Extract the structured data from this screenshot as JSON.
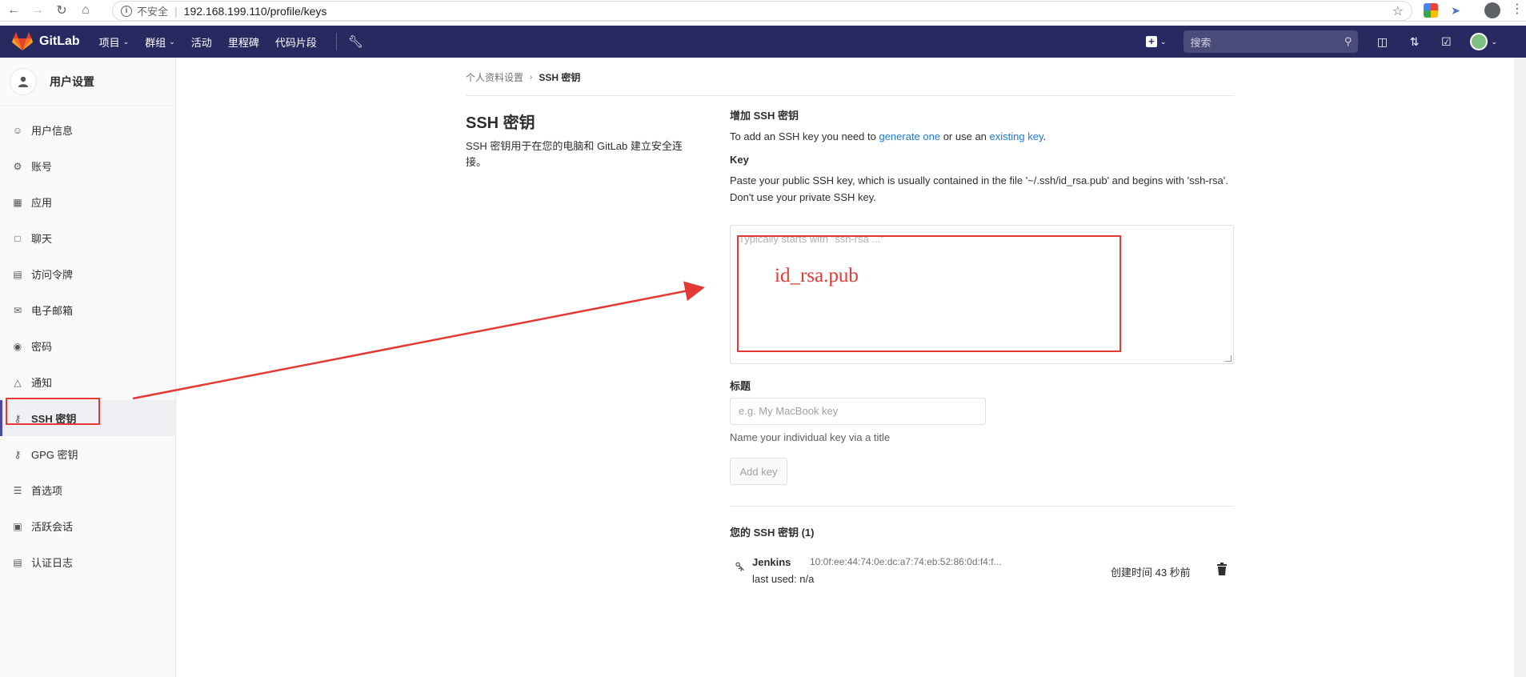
{
  "browser": {
    "insecure_label": "不安全",
    "url": "192.168.199.110/profile/keys"
  },
  "navbar": {
    "brand": "GitLab",
    "menu": [
      {
        "label": "项目",
        "has_caret": true
      },
      {
        "label": "群组",
        "has_caret": true
      },
      {
        "label": "活动",
        "has_caret": false
      },
      {
        "label": "里程碑",
        "has_caret": false
      },
      {
        "label": "代码片段",
        "has_caret": false
      }
    ],
    "search_placeholder": "搜索"
  },
  "sidebar": {
    "title": "用户设置",
    "items": [
      {
        "label": "用户信息",
        "icon": "profile-icon"
      },
      {
        "label": "账号",
        "icon": "account-icon"
      },
      {
        "label": "应用",
        "icon": "applications-icon"
      },
      {
        "label": "聊天",
        "icon": "chat-icon"
      },
      {
        "label": "访问令牌",
        "icon": "token-icon"
      },
      {
        "label": "电子邮箱",
        "icon": "mail-icon"
      },
      {
        "label": "密码",
        "icon": "lock-icon"
      },
      {
        "label": "通知",
        "icon": "bell-icon"
      },
      {
        "label": "SSH 密钥",
        "icon": "key-icon",
        "active": true
      },
      {
        "label": "GPG 密钥",
        "icon": "key-icon"
      },
      {
        "label": "首选项",
        "icon": "preferences-icon"
      },
      {
        "label": "活跃会话",
        "icon": "monitor-icon"
      },
      {
        "label": "认证日志",
        "icon": "log-icon"
      }
    ]
  },
  "breadcrumb": {
    "parent": "个人资料设置",
    "current": "SSH 密钥"
  },
  "intro": {
    "title": "SSH 密钥",
    "description": "SSH 密钥用于在您的电脑和 GitLab 建立安全连接。"
  },
  "form": {
    "heading": "增加 SSH 密钥",
    "add_text_before": "To add an SSH key you need to ",
    "generate_link": "generate one",
    "add_text_middle": " or use an ",
    "existing_link": "existing key",
    "add_text_after": ".",
    "key_label": "Key",
    "key_help": "Paste your public SSH key, which is usually contained in the file '~/.ssh/id_rsa.pub' and begins with 'ssh-rsa'. Don't use your private SSH key.",
    "key_placeholder": "Typically starts with \"ssh-rsa ...\"",
    "title_label": "标题",
    "title_placeholder": "e.g. My MacBook key",
    "title_help": "Name your individual key via a title",
    "add_button": "Add key"
  },
  "annotation": {
    "text": "id_rsa.pub",
    "color": "#e53935"
  },
  "keys": {
    "heading": "您的 SSH 密钥 (1)",
    "items": [
      {
        "name": "Jenkins",
        "fingerprint": "10:0f:ee:44:74:0e:dc:a7:74:eb:52:86:0d:f4:f...",
        "last_used": "last used: n/a",
        "created": "创建时间 43 秒前"
      }
    ]
  },
  "colors": {
    "navbar": "#292961",
    "link": "#1f78d1",
    "highlight": "#e53935"
  }
}
